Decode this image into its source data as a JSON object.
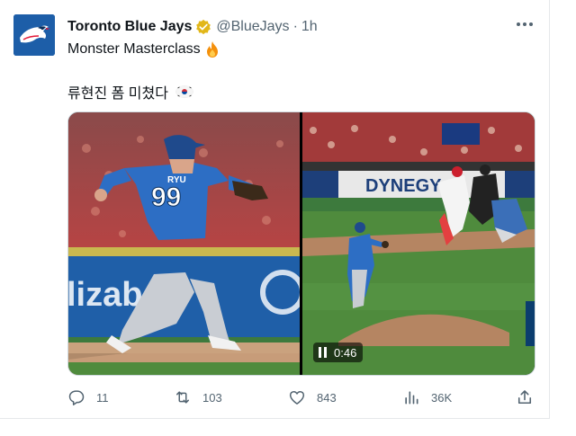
{
  "tweet": {
    "author_name": "Toronto Blue Jays",
    "handle": "@BlueJays",
    "separator": "·",
    "time": "1h",
    "line1": "Monster Masterclass",
    "line2": "류현진 폼 미쳤다",
    "fire_emoji": "🔥",
    "flag_emoji": "🇰🇷"
  },
  "media": {
    "jersey_name": "RYU",
    "jersey_number": "99",
    "video_timestamp": "0:46",
    "stadium_ad": "DYNEGY",
    "banner_left": "lizabe"
  },
  "actions": {
    "reply_count": "11",
    "retweet_count": "103",
    "like_count": "843",
    "views_count": "36K"
  },
  "colors": {
    "accent": "#1d9bf0",
    "muted": "#536471",
    "jays_blue": "#1d5ea8"
  }
}
